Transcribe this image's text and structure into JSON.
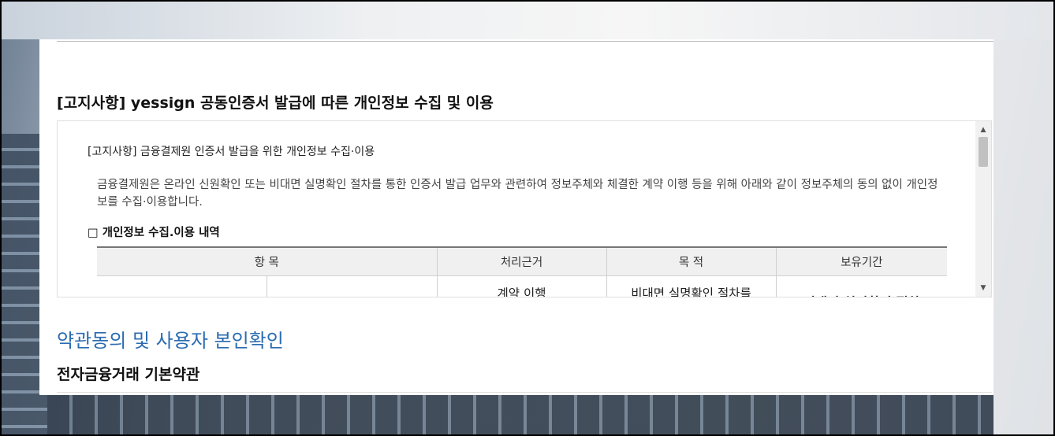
{
  "notice": {
    "title": "[고지사항] yessign 공동인증서 발급에 따른 개인정보 수집 및 이용",
    "sub_heading": "[고지사항] 금융결제원 인증서 발급을 위한 개인정보 수집·이용",
    "intro": "금융결제원은 온라인 신원확인 또는 비대면 실명확인 절차를 통한 인증서 발급 업무와 관련하여 정보주체와 체결한 계약 이행 등을 위해 아래와 같이 정보주체의 동의 없이 개인정보를 수집·이용합니다.",
    "section_label": "□ 개인정보 수집.이용 내역",
    "table": {
      "headers": [
        "항 목",
        "처리근거",
        "목 적",
        "보유기간"
      ],
      "row": [
        "",
        "",
        "계약 이행",
        "비대면 실명확인 절차를",
        "비대면 실명확인 절차"
      ]
    }
  },
  "scrollbar": {
    "up_icon": "▲",
    "down_icon": "▼"
  },
  "agreement": {
    "title": "약관동의 및 사용자 본인확인",
    "terms_title": "전자금융거래 기본약관"
  }
}
